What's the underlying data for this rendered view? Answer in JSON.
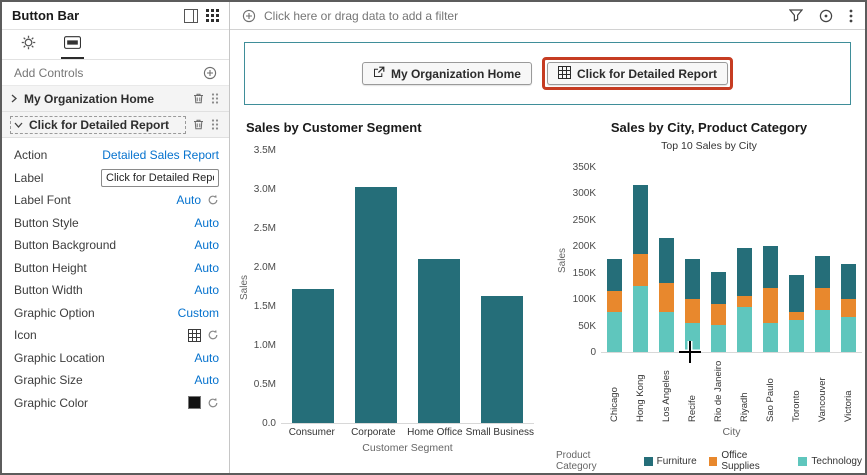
{
  "window": {
    "title": "Button Bar"
  },
  "colors": {
    "teal": "#256e79",
    "orange": "#e8882d",
    "light_teal": "#5fc6bd",
    "link_blue": "#0572ce",
    "annotation_red": "#c63c22",
    "container_border_teal": "#3f8e99",
    "swatch_black": "#111111"
  },
  "sidebar": {
    "title": "Button Bar",
    "add_controls_label": "Add Controls",
    "controls": [
      {
        "label": "My Organization Home",
        "expanded": false
      },
      {
        "label": "Click for Detailed Report",
        "expanded": true
      }
    ],
    "properties": [
      {
        "label": "Action",
        "type": "link",
        "value": "Detailed Sales Report"
      },
      {
        "label": "Label",
        "type": "input",
        "value": "Click for Detailed Report"
      },
      {
        "label": "Label Font",
        "type": "auto-reset",
        "value": "Auto"
      },
      {
        "label": "Button Style",
        "type": "auto",
        "value": "Auto"
      },
      {
        "label": "Button Background",
        "type": "auto",
        "value": "Auto"
      },
      {
        "label": "Button Height",
        "type": "auto",
        "value": "Auto"
      },
      {
        "label": "Button Width",
        "type": "auto",
        "value": "Auto"
      },
      {
        "label": "Graphic Option",
        "type": "auto",
        "value": "Custom"
      },
      {
        "label": "Icon",
        "type": "icon-reset",
        "value": "grid-icon"
      },
      {
        "label": "Graphic Location",
        "type": "auto",
        "value": "Auto"
      },
      {
        "label": "Graphic Size",
        "type": "auto",
        "value": "Auto"
      },
      {
        "label": "Graphic Color",
        "type": "swatch-reset",
        "value": "#111111"
      }
    ]
  },
  "filter_bar": {
    "placeholder": "Click here or drag data to add a filter"
  },
  "button_bar": {
    "buttons": [
      {
        "label": "My Organization Home",
        "icon": "external-link-icon",
        "highlighted": false
      },
      {
        "label": "Click for Detailed Report",
        "icon": "grid-icon",
        "highlighted": true
      }
    ]
  },
  "chart_data": [
    {
      "type": "bar",
      "title": "Sales by Customer Segment",
      "categories": [
        "Consumer",
        "Corporate",
        "Home Office",
        "Small Business"
      ],
      "values": [
        1.72,
        3.02,
        2.1,
        1.63
      ],
      "unit": "M",
      "ylabel": "Sales",
      "xlabel": "Customer Segment",
      "yticks": [
        "3.5M",
        "3.0M",
        "2.5M",
        "2.0M",
        "1.5M",
        "1.0M",
        "0.5M",
        "0.0"
      ],
      "ymax": 3.5,
      "grid": false,
      "bar_color_key": "teal"
    },
    {
      "type": "stacked-bar",
      "title": "Sales by City, Product Category",
      "subtitle": "Top 10 Sales by City",
      "categories": [
        "Chicago",
        "Hong Kong",
        "Los Angeles",
        "Recife",
        "Rio de Janeiro",
        "Riyadh",
        "Sao Paulo",
        "Toronto",
        "Vancouver",
        "Victoria"
      ],
      "series": [
        {
          "name": "Technology",
          "color": "#5fc6bd",
          "values": [
            75,
            125,
            75,
            55,
            50,
            85,
            55,
            60,
            80,
            65
          ]
        },
        {
          "name": "Office Supplies",
          "color": "#e8882d",
          "values": [
            40,
            60,
            55,
            45,
            40,
            20,
            65,
            15,
            40,
            35
          ]
        },
        {
          "name": "Furniture",
          "color": "#256e79",
          "values": [
            60,
            130,
            85,
            75,
            60,
            90,
            80,
            70,
            60,
            65
          ]
        }
      ],
      "unit": "K",
      "ylabel": "Sales",
      "xlabel": "City",
      "legend_title": "Product Category",
      "legend_order": [
        "Furniture",
        "Office Supplies",
        "Technology"
      ],
      "legend_position": "bottom",
      "yticks": [
        "350K",
        "300K",
        "250K",
        "200K",
        "150K",
        "100K",
        "50K",
        "0"
      ],
      "ymax": 350,
      "grid": false
    }
  ]
}
